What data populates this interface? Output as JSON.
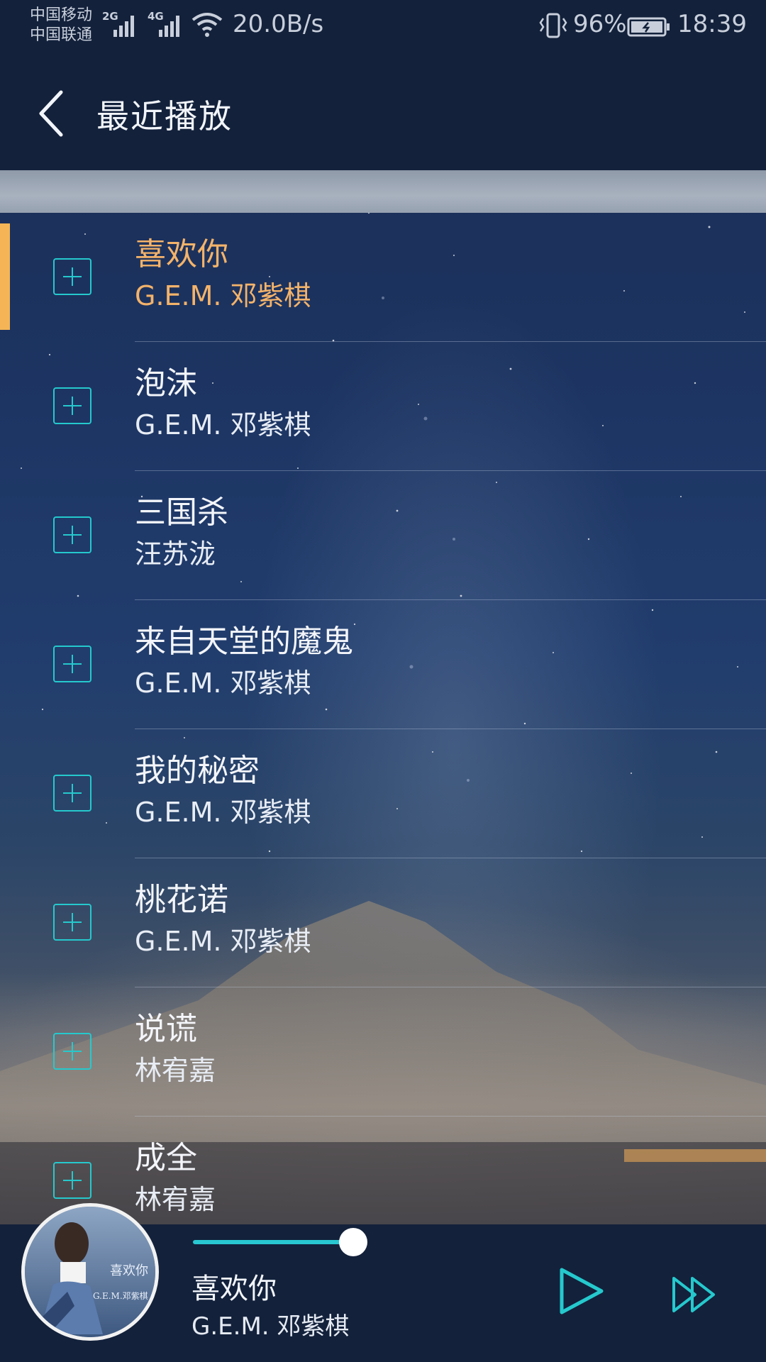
{
  "status_bar": {
    "carrier_1": "中国移动",
    "carrier_2": "中国联通",
    "net_1": "2G",
    "net_2": "4G",
    "speed": "20.0B/s",
    "battery": "96%",
    "time": "18:39"
  },
  "header": {
    "title": "最近播放"
  },
  "songs": [
    {
      "title": "喜欢你",
      "artist": "G.E.M. 邓紫棋",
      "active": true
    },
    {
      "title": "泡沫",
      "artist": "G.E.M. 邓紫棋"
    },
    {
      "title": "三国杀",
      "artist": "汪苏泷"
    },
    {
      "title": "来自天堂的魔鬼",
      "artist": "G.E.M. 邓紫棋"
    },
    {
      "title": "我的秘密",
      "artist": "G.E.M. 邓紫棋"
    },
    {
      "title": "桃花诺",
      "artist": "G.E.M. 邓紫棋"
    },
    {
      "title": "说谎",
      "artist": "林宥嘉"
    },
    {
      "title": "成全",
      "artist": "林宥嘉"
    }
  ],
  "player": {
    "title": "喜欢你",
    "artist": "G.E.M. 邓紫棋",
    "album_art_text": "喜欢你",
    "album_art_caption": "G.E.M.邓紫棋"
  },
  "colors": {
    "accent": "#25c9cd",
    "active": "#f4b36a",
    "bar": "#13213b"
  },
  "icons": [
    "back-icon",
    "plus-icon",
    "play-icon",
    "next-icon",
    "wifi-icon",
    "signal-icon",
    "battery-icon",
    "vibrate-icon"
  ]
}
